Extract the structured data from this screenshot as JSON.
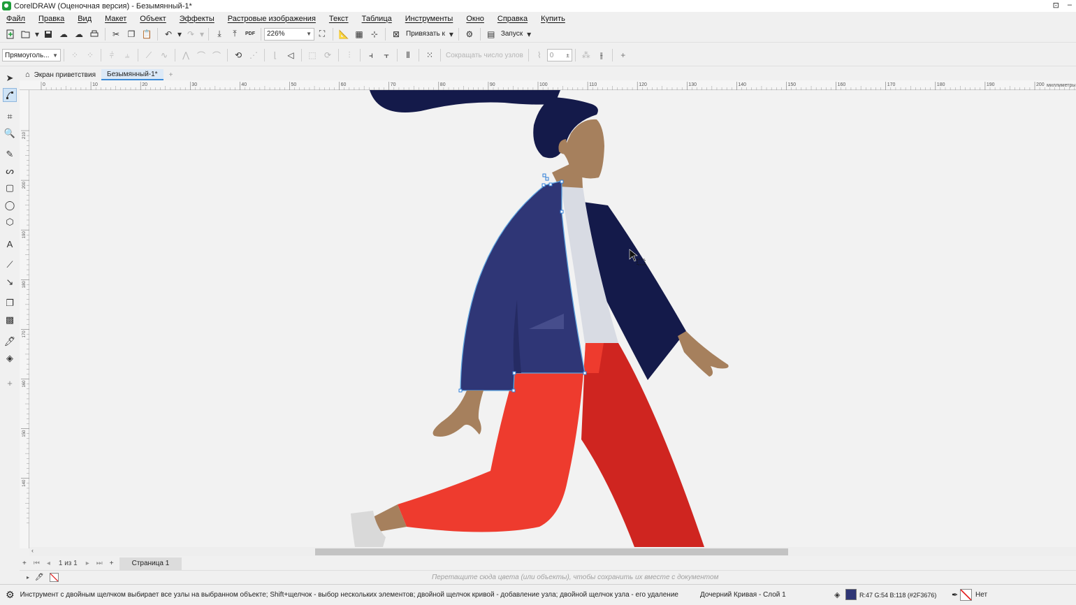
{
  "window": {
    "title": "CorelDRAW (Оценочная версия) - Безымянный-1*"
  },
  "menu": [
    "Файл",
    "Правка",
    "Вид",
    "Макет",
    "Объект",
    "Эффекты",
    "Растровые изображения",
    "Текст",
    "Таблица",
    "Инструменты",
    "Окно",
    "Справка",
    "Купить"
  ],
  "toolbar": {
    "zoom": "226%",
    "snap_label": "Привязать к",
    "launch_label": "Запуск"
  },
  "property_bar": {
    "selection_mode": "Прямоуголь...",
    "reduce_nodes_label": "Сокращать число узлов",
    "smoothness_value": "0"
  },
  "doc_tabs": [
    {
      "label": "Экран приветствия"
    },
    {
      "label": "Безымянный-1*"
    }
  ],
  "ruler": {
    "unit_label": "миллиметры",
    "h_ticks": [
      "0",
      "10",
      "20",
      "30",
      "40",
      "50",
      "60",
      "70",
      "80",
      "90",
      "100",
      "110",
      "120",
      "130",
      "140",
      "150",
      "160",
      "170",
      "180",
      "190",
      "200"
    ],
    "v_ticks": [
      "210",
      "200",
      "190",
      "180",
      "170",
      "160",
      "150",
      "140"
    ]
  },
  "pages": {
    "counter": "1 из 1",
    "tab": "Страница 1"
  },
  "palette_hint": "Перетащите сюда цвета (или объекты), чтобы сохранить их вместе с документом",
  "status": {
    "hint": "Инструмент с двойным щелчком выбирает все узлы на выбранном объекте; Shift+щелчок - выбор нескольких элементов; двойной щелчок кривой - добавление узла; двойной щелчок узла - его удаление",
    "object_info": "Дочерний Кривая - Слой 1",
    "fill_info": "R:47 G:54 B:118 (#2F3676)",
    "outline_info": "Нет"
  },
  "colors": {
    "jacket": "#2f3676",
    "hair": "#141a4a",
    "skin": "#a6805d",
    "shirt": "#d8dbe3",
    "pants": "#ee3b2e",
    "pants_dark": "#cf2520",
    "shoe": "#d9d9d9",
    "selection": "#5ea4e0"
  }
}
